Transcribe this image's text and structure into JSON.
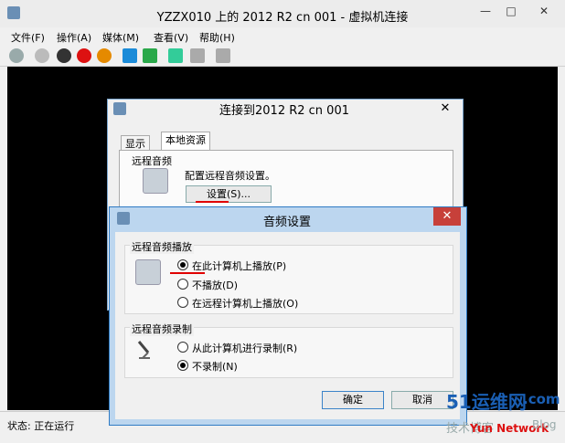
{
  "window": {
    "title": "YZZX010 上的 2012 R2 cn 001 - 虚拟机连接",
    "controls": [
      "—",
      "□",
      "✕"
    ]
  },
  "menu": [
    "文件(F)",
    "操作(A)",
    "媒体(M)",
    "查看(V)",
    "帮助(H)"
  ],
  "toolbar_icons": [
    "ctrl-alt-del-icon",
    "start-icon",
    "stop-icon",
    "shutdown-icon",
    "power-icon",
    "pause-icon",
    "resume-icon",
    "checkpoint-icon",
    "revert-icon",
    "enhanced-session-icon"
  ],
  "status": "状态: 正在运行",
  "connect_dialog": {
    "title": "连接到2012 R2 cn 001",
    "close": "✕",
    "tabs": [
      "显示",
      "本地资源"
    ],
    "section": "远程音频",
    "description": "配置远程音频设置。",
    "settings_button": "设置(S)..."
  },
  "audio_dialog": {
    "title": "音频设置",
    "close": "✕",
    "playback_group": "远程音频播放",
    "playback_options": [
      "在此计算机上播放(P)",
      "不播放(D)",
      "在远程计算机上播放(O)"
    ],
    "playback_selected": 0,
    "recording_group": "远程音频录制",
    "recording_options": [
      "从此计算机进行录制(R)",
      "不录制(N)"
    ],
    "recording_selected": 1,
    "ok": "确定",
    "cancel": "取消"
  },
  "watermark": {
    "line1": "51运维网",
    "line1b": ".com",
    "line2": "技术博客",
    "line3": "Yun Network",
    "line4": "Blog"
  }
}
